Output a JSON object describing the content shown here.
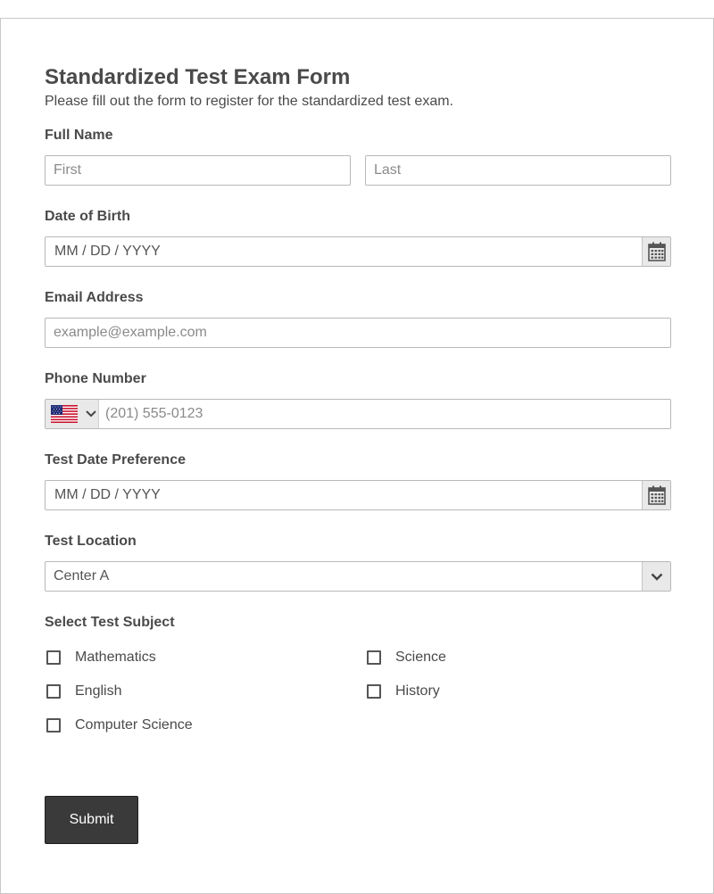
{
  "form": {
    "title": "Standardized Test Exam Form",
    "subtitle": "Please fill out the form to register for the standardized test exam."
  },
  "full_name": {
    "label": "Full Name",
    "first_placeholder": "First",
    "last_placeholder": "Last"
  },
  "dob": {
    "label": "Date of Birth",
    "placeholder": "MM / DD / YYYY",
    "icon": "calendar-icon"
  },
  "email": {
    "label": "Email Address",
    "placeholder": "example@example.com"
  },
  "phone": {
    "label": "Phone Number",
    "placeholder": "(201) 555-0123",
    "country_icon": "us-flag-icon"
  },
  "test_date": {
    "label": "Test Date Preference",
    "placeholder": "MM / DD / YYYY",
    "icon": "calendar-icon"
  },
  "location": {
    "label": "Test Location",
    "selected": "Center A"
  },
  "subjects": {
    "label": "Select Test Subject",
    "options": [
      "Mathematics",
      "Science",
      "English",
      "History",
      "Computer Science"
    ]
  },
  "submit_label": "Submit",
  "colors": {
    "button_bg": "#3a3a3a",
    "text": "#4a4a4a",
    "border": "#b8b8b8",
    "addon_bg": "#e9e9e9"
  }
}
